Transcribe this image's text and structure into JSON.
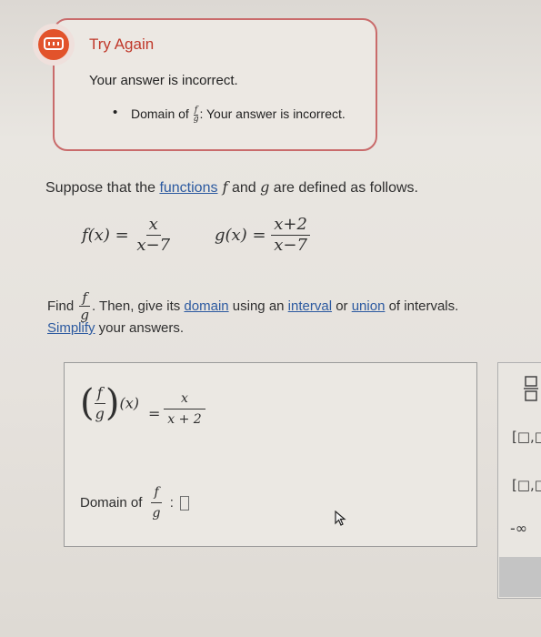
{
  "feedback": {
    "title": "Try Again",
    "message": "Your answer is incorrect.",
    "bullet": "•",
    "item_prefix": "Domain of",
    "item_frac_num": "f",
    "item_frac_den": "g",
    "item_suffix": ": Your answer is incorrect."
  },
  "problem": {
    "p1": "Suppose that the ",
    "link_functions": "functions",
    "p2": " f",
    "p3": " and ",
    "p4": "g",
    "p5": " are defined as follows."
  },
  "defs": {
    "f_label": "f(x) =",
    "f_num": "x",
    "f_den": "x−7",
    "g_label": "g(x) =",
    "g_num": "x+2",
    "g_den": "x−7"
  },
  "instructions": {
    "find": "Find",
    "frac_num": "f",
    "frac_den": "g",
    "then": ". Then, give its ",
    "link_domain": "domain",
    "using": " using an ",
    "link_interval": "interval",
    "or": " or ",
    "link_union": "union",
    "of": " of intervals.",
    "link_simplify": "Simplify",
    "simplify_rest": " your answers."
  },
  "answer": {
    "lhs_num": "f",
    "lhs_den": "g",
    "lhs_arg": "(x)",
    "eq": "=",
    "rhs_num": "x",
    "rhs_den": "x + 2",
    "domain_label": "Domain of",
    "domain_frac_num": "f",
    "domain_frac_den": "g",
    "domain_colon": ":"
  },
  "tools": {
    "fraction_icon": "fraction-icon",
    "interval_closed_open": "[□,□",
    "interval_closed": "[□,□",
    "neg_infinity": "-∞"
  },
  "colors": {
    "error_red": "#e2532b",
    "border_red": "#c96b6b",
    "link_blue": "#2c5aa0"
  }
}
